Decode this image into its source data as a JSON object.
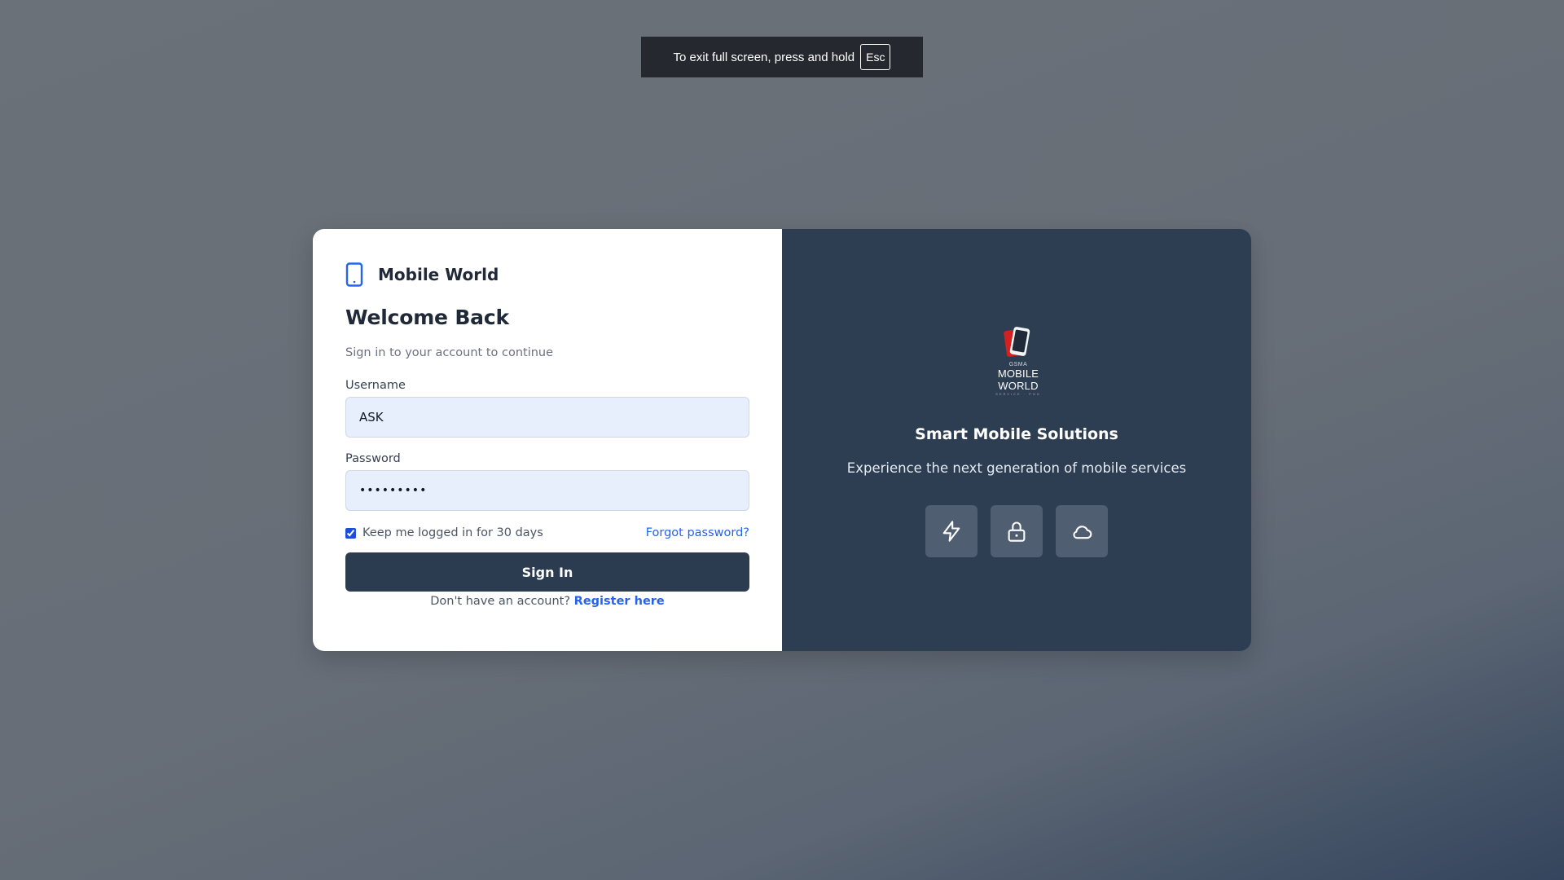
{
  "fullscreen_notice": {
    "text": "To exit full screen, press and hold",
    "key": "Esc"
  },
  "brand": {
    "name": "Mobile World",
    "icon": "smartphone-icon",
    "accent_color": "#2563eb"
  },
  "login": {
    "title": "Welcome Back",
    "subtitle": "Sign in to your account to continue",
    "username_label": "Username",
    "username_value": "ASK",
    "password_label": "Password",
    "password_value": "•••••••••",
    "remember_label": "Keep me logged in for 30 days",
    "remember_checked": true,
    "forgot_label": "Forgot password?",
    "signin_label": "Sign In",
    "no_account_text": "Don't have an account?",
    "register_label": "Register here"
  },
  "promo": {
    "logo_small": "GSMA",
    "logo_name": "MOBILE WORLD",
    "logo_tag": "SERVICE · PNG",
    "tagline": "Smart Mobile Solutions",
    "description": "Experience the next generation of mobile services",
    "features": [
      {
        "icon": "lightning-icon"
      },
      {
        "icon": "lock-icon"
      },
      {
        "icon": "cloud-icon"
      }
    ]
  },
  "colors": {
    "panel_dark": "#2e3e52",
    "button_dark": "#2b3b50",
    "input_bg": "#e8effc",
    "link": "#2563eb"
  }
}
